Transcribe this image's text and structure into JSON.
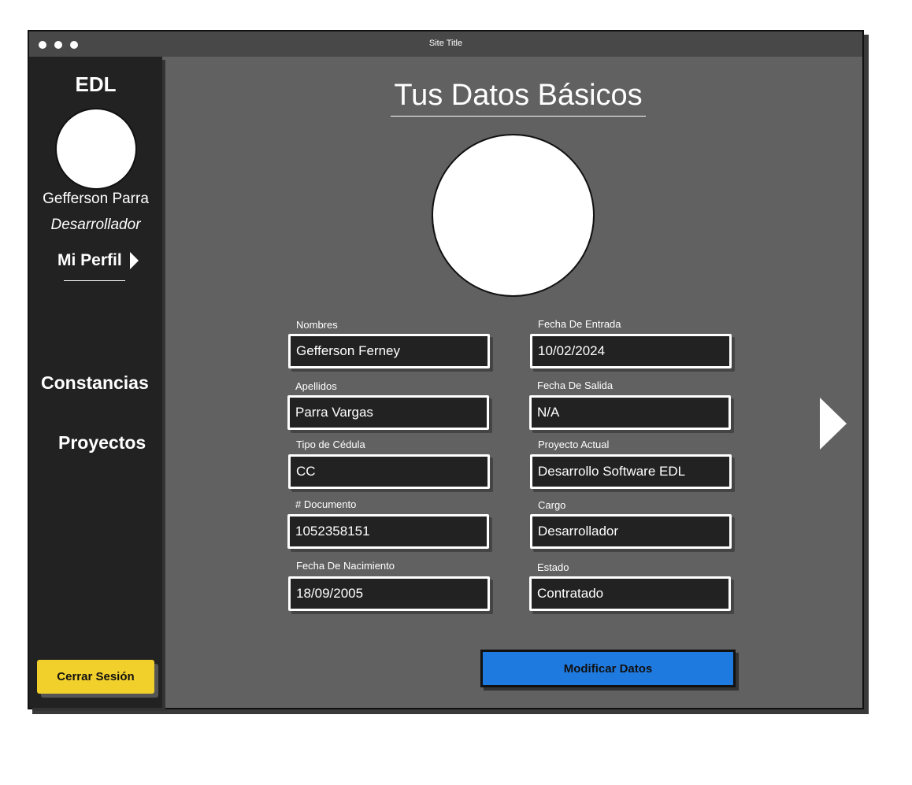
{
  "window": {
    "title": "Site Title"
  },
  "sidebar": {
    "brand": "EDL",
    "user_name": "Gefferson Parra",
    "user_role": "Desarrollador",
    "profile_link": "Mi Perfil",
    "nav": [
      {
        "label": "Constancias"
      },
      {
        "label": "Proyectos"
      }
    ],
    "logout_label": "Cerrar Sesión"
  },
  "main": {
    "title": "Tus Datos Básicos",
    "left_fields": [
      {
        "label": "Nombres",
        "value": "Gefferson Ferney"
      },
      {
        "label": "Apellidos",
        "value": "Parra Vargas"
      },
      {
        "label": "Tipo de Cédula",
        "value": "CC"
      },
      {
        "label": "# Documento",
        "value": "1052358151"
      },
      {
        "label": "Fecha De Nacimiento",
        "value": "18/09/2005"
      }
    ],
    "right_fields": [
      {
        "label": "Fecha De Entrada",
        "value": "10/02/2024"
      },
      {
        "label": "Fecha De Salida",
        "value": "N/A"
      },
      {
        "label": "Proyecto Actual",
        "value": "Desarrollo Software EDL"
      },
      {
        "label": "Cargo",
        "value": "Desarrollador"
      },
      {
        "label": "Estado",
        "value": "Contratado"
      }
    ],
    "modify_label": "Modificar Datos"
  },
  "colors": {
    "sidebar_bg": "#222222",
    "content_bg": "#616161",
    "logout_button": "#f2d02b",
    "modify_button": "#1f7ae0"
  },
  "icons": [
    "window-control-dots",
    "chevron-right-icon",
    "next-arrow-icon",
    "avatar-placeholder"
  ]
}
